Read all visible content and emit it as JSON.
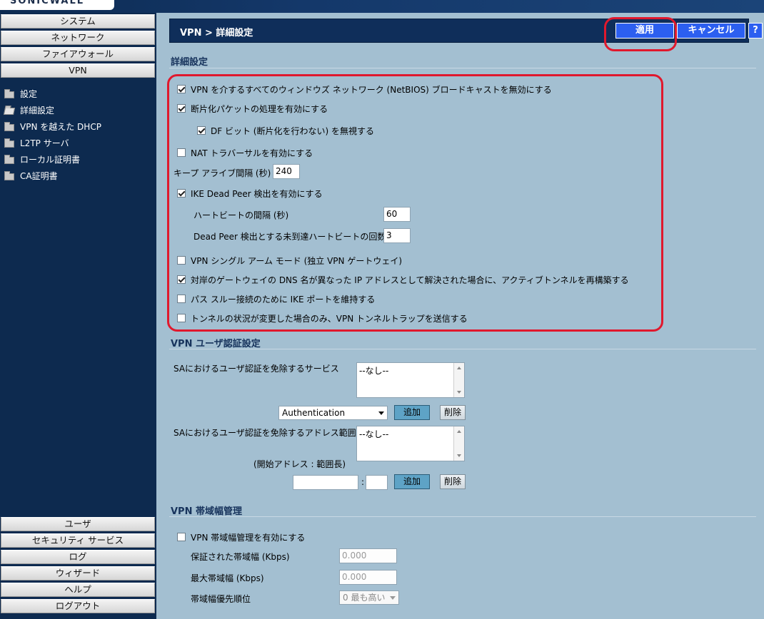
{
  "brand": {
    "logo_text": "SONICWALL"
  },
  "sidebar": {
    "top_menu": [
      "システム",
      "ネットワーク",
      "ファイアウォール",
      "VPN"
    ],
    "sub_items": [
      "設定",
      "詳細設定",
      "VPN を越えた DHCP",
      "L2TP サーバ",
      "ローカル証明書",
      "CA証明書"
    ],
    "bottom_menu": [
      "ユーザ",
      "セキュリティ サービス",
      "ログ",
      "ウィザード",
      "ヘルプ",
      "ログアウト"
    ]
  },
  "header": {
    "breadcrumb": "VPN > 詳細設定",
    "apply_label": "適用",
    "cancel_label": "キャンセル",
    "help_label": "?"
  },
  "advanced": {
    "title": "詳細設定",
    "netbios_label": "VPN を介するすべてのウィンドウズ ネットワーク (NetBIOS) ブロードキャストを無効にする",
    "fragment_label": "断片化パケットの処理を有効にする",
    "df_label": "DF ビット (断片化を行わない) を無視する",
    "nat_label": "NAT トラバーサルを有効にする",
    "keepalive_label": "キープ アライブ間隔 (秒)",
    "keepalive_value": "240",
    "ike_dpd_label": "IKE Dead Peer 検出を有効にする",
    "heartbeat_label": "ハートビートの間隔 (秒)",
    "heartbeat_value": "60",
    "missed_label": "Dead Peer 検出とする未到達ハートビートの回数",
    "missed_value": "3",
    "single_arm_label": "VPN シングル アーム モード (独立 VPN ゲートウェイ)",
    "dns_rebuild_label": "対岸のゲートウェイの DNS 名が異なった IP アドレスとして解決された場合に、アクティブトンネルを再構築する",
    "ike_port_label": "パス スルー接続のために IKE ポートを維持する",
    "trap_label": "トンネルの状況が変更した場合のみ、VPN トンネルトラップを送信する"
  },
  "user_auth": {
    "title": "VPN ユーザ認証設定",
    "services_label": "SAにおけるユーザ認証を免除するサービス",
    "services_list": "--なし--",
    "service_select": "Authentication",
    "add_label": "追加",
    "delete_label": "削除",
    "range_label": "SAにおけるユーザ認証を免除するアドレス範囲",
    "range_list": "--なし--",
    "range_hint": "(開始アドレス : 範囲長)",
    "colon": ":"
  },
  "bandwidth": {
    "title": "VPN 帯域幅管理",
    "enable_label": "VPN 帯域幅管理を有効にする",
    "guaranteed_label": "保証された帯域幅 (Kbps)",
    "guaranteed_value": "0.000",
    "max_label": "最大帯域幅 (Kbps)",
    "max_value": "0.000",
    "priority_label": "帯域幅優先順位",
    "priority_value": "0 最も高い"
  }
}
